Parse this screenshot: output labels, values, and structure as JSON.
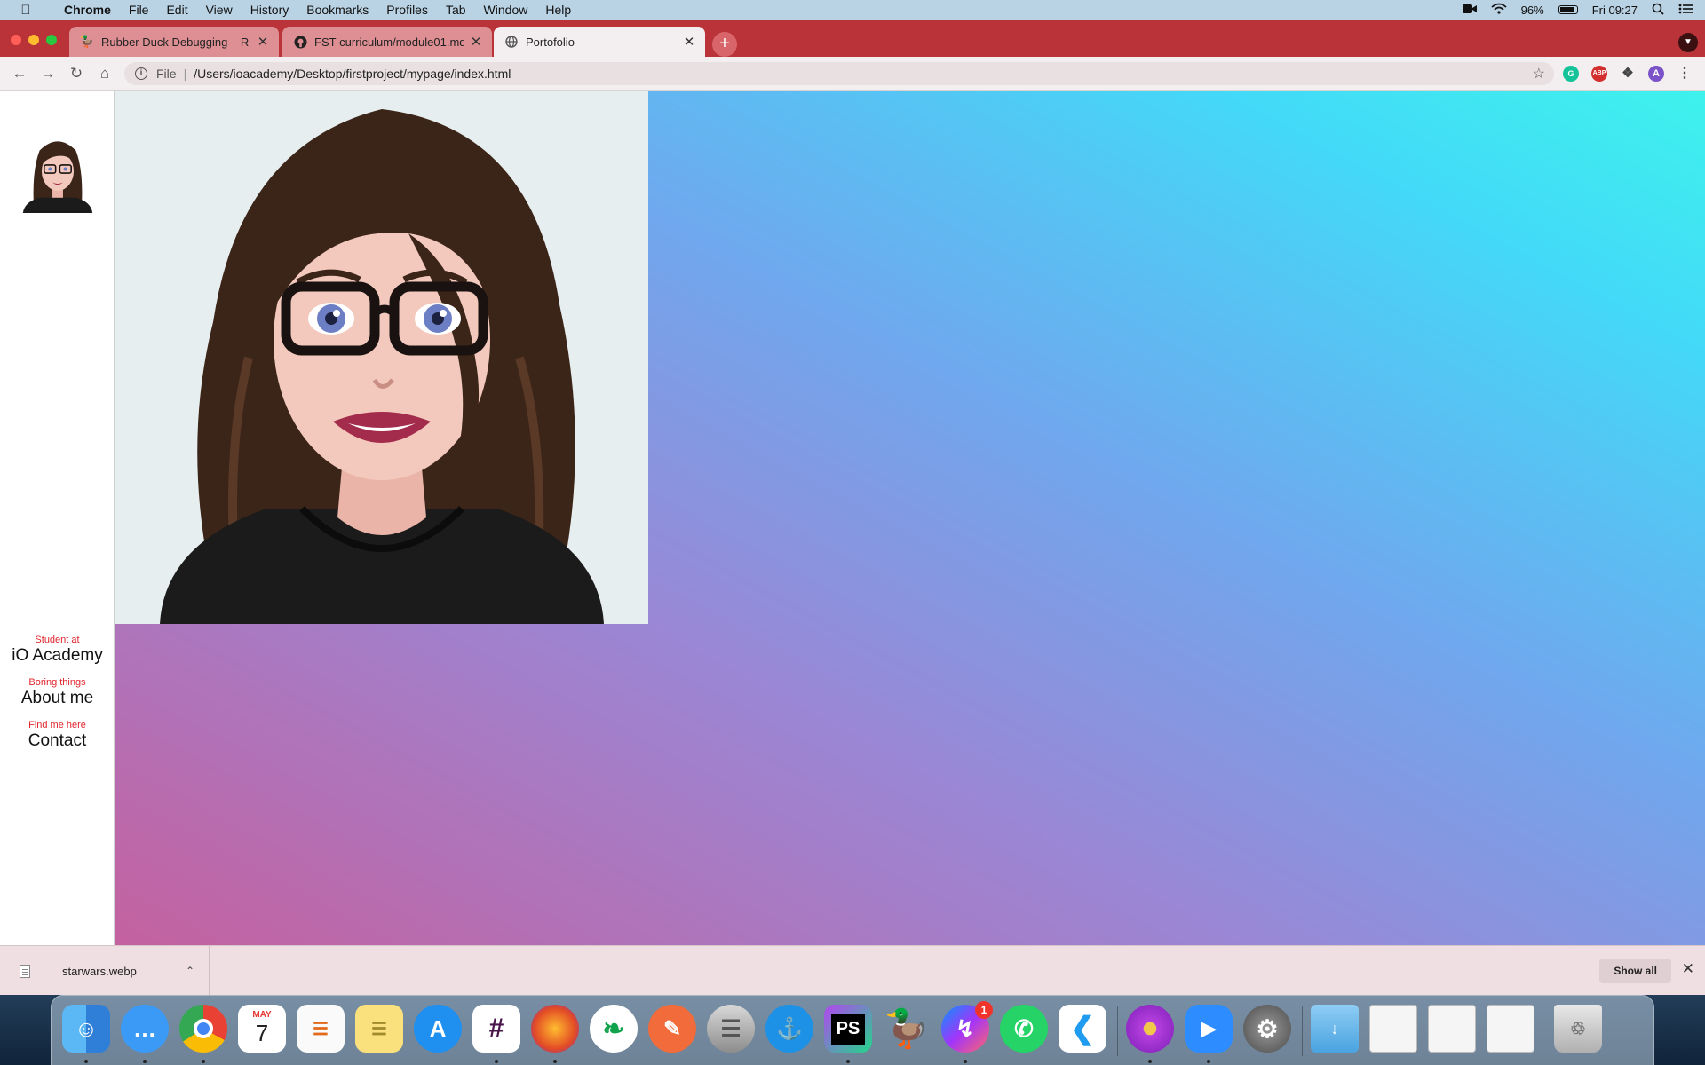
{
  "menubar": {
    "app_name": "Chrome",
    "menus": [
      "File",
      "Edit",
      "View",
      "History",
      "Bookmarks",
      "Profiles",
      "Tab",
      "Window",
      "Help"
    ],
    "battery": "96%",
    "clock": "Fri 09:27"
  },
  "tabs": [
    {
      "title": "Rubber Duck Debugging – Rub",
      "icon": "duck-icon",
      "active": false
    },
    {
      "title": "FST-curriculum/module01.md",
      "icon": "github-icon",
      "active": false
    },
    {
      "title": "Portofolio",
      "icon": "globe-icon",
      "active": true
    }
  ],
  "toolbar": {
    "scheme": "File",
    "url": "/Users/ioacademy/Desktop/firstproject/mypage/index.html",
    "profile_initial": "A",
    "extension_abp": "ABP"
  },
  "page": {
    "nav": [
      {
        "caption": "Student at",
        "label": "iO Academy"
      },
      {
        "caption": "Boring things",
        "label": "About me"
      },
      {
        "caption": "Find me here",
        "label": "Contact"
      }
    ],
    "colors": {
      "nav_caption": "#e0242c",
      "gradient_start": "#c4619f",
      "gradient_end": "#3ef2ec",
      "hero_bg": "#e7eeef"
    }
  },
  "downloads": {
    "file_name": "starwars.webp",
    "show_all": "Show all"
  },
  "dock": {
    "calendar_month": "MAY",
    "calendar_day": "7",
    "phpstorm_label": "PS",
    "messenger_badge": "1",
    "apps": [
      "Finder",
      "Messages",
      "Chrome",
      "Calendar",
      "Reminders",
      "Notes",
      "App Store",
      "Slack",
      "Firefox",
      "MongoDB Compass",
      "Postman",
      "Sequel Pro",
      "Docker",
      "PhpStorm",
      "Rubber Duck",
      "Messenger",
      "WhatsApp",
      "VS Code",
      "Flower",
      "Zoom",
      "System Preferences"
    ]
  }
}
